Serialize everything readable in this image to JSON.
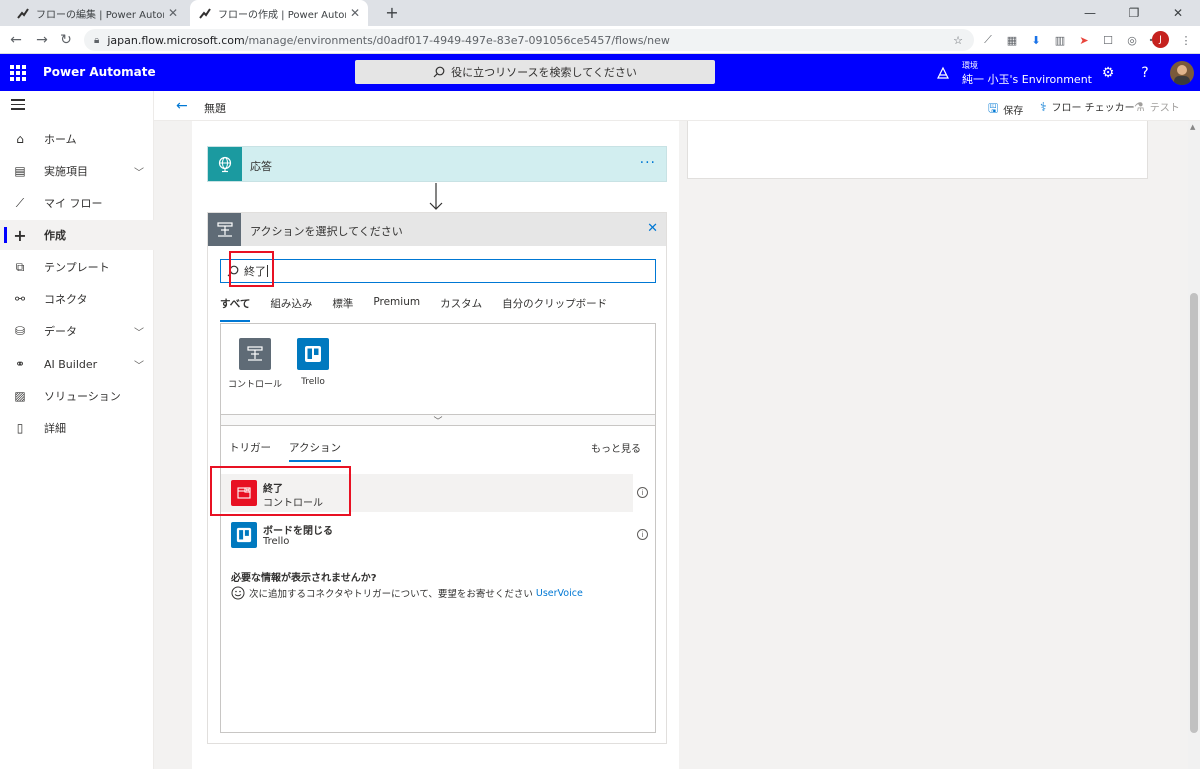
{
  "browser": {
    "tabs": [
      {
        "title": "フローの編集 | Power Automate",
        "active": false
      },
      {
        "title": "フローの作成 | Power Automate",
        "active": true
      }
    ],
    "url_host": "japan.flow.microsoft.com",
    "url_path": "/manage/environments/d0adf017-4949-497e-83e7-091056ce5457/flows/new",
    "profile_initial": "J"
  },
  "header": {
    "app_name": "Power Automate",
    "search_placeholder": "役に立つリソースを検索してください",
    "env_label": "環境",
    "env_name": "純一 小玉's Environment",
    "help": "?"
  },
  "leftnav": {
    "items": [
      {
        "label": "ホーム",
        "icon": "home-icon",
        "chevron": false
      },
      {
        "label": "実施項目",
        "icon": "clipboard-icon",
        "chevron": true
      },
      {
        "label": "マイ フロー",
        "icon": "flow-icon",
        "chevron": false
      },
      {
        "label": "作成",
        "icon": "plus-icon",
        "chevron": false,
        "selected": true
      },
      {
        "label": "テンプレート",
        "icon": "template-icon",
        "chevron": false
      },
      {
        "label": "コネクタ",
        "icon": "connector-icon",
        "chevron": false
      },
      {
        "label": "データ",
        "icon": "database-icon",
        "chevron": true
      },
      {
        "label": "AI Builder",
        "icon": "ai-icon",
        "chevron": true
      },
      {
        "label": "ソリューション",
        "icon": "solution-icon",
        "chevron": false
      },
      {
        "label": "詳細",
        "icon": "book-icon",
        "chevron": false
      }
    ]
  },
  "cmdbar": {
    "flow_name": "無題",
    "save": "保存",
    "checker": "フロー チェッカー",
    "test": "テスト"
  },
  "designer": {
    "response_step": "応答",
    "action_title": "アクションを選択してください",
    "search_value": "終了",
    "tabs": [
      "すべて",
      "組み込み",
      "標準",
      "Premium",
      "カスタム",
      "自分のクリップボード"
    ],
    "connectors": [
      {
        "label": "コントロール",
        "color": "#5f6b76"
      },
      {
        "label": "Trello",
        "color": "#0079bf"
      }
    ],
    "subtabs": [
      "トリガー",
      "アクション"
    ],
    "see_more": "もっと見る",
    "actions": [
      {
        "name": "終了",
        "connector": "コントロール",
        "color": "#e81123"
      },
      {
        "name": "ボードを閉じる",
        "connector": "Trello",
        "color": "#0079bf"
      }
    ],
    "missing_title": "必要な情報が表示されませんか?",
    "missing_text": "次に追加するコネクタやトリガーについて、要望をお寄せください",
    "missing_link": "UserVoice"
  },
  "colors": {
    "header_bg": "#0000ff",
    "accent": "#0078d4",
    "highlight": "#e81123",
    "response_bg": "#d2eef0",
    "response_icon": "#1b9aa0"
  }
}
